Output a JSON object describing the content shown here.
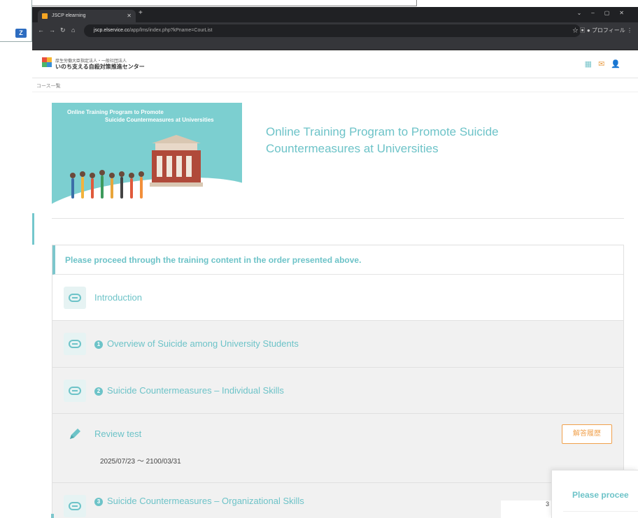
{
  "browser": {
    "tab_title": "JSCP elearning",
    "url_host": "jscp.elservice.cc",
    "url_path": "/app/lms/index.php?kPname=CourList",
    "profile_label": "プロフィール"
  },
  "taskbar": {
    "zoom_badge": "Z"
  },
  "site": {
    "org_small": "厚生労働大臣指定法人・一般社団法人",
    "org_name": "いのち支える自殺対策推進センター",
    "breadcrumb": "コース一覧"
  },
  "hero": {
    "banner_line1": "Online Training Program to Promote",
    "banner_line2": "Suicide Countermeasures at Universities",
    "title": "Online Training Program to Promote Suicide Countermeasures at Universities"
  },
  "notice": "Please proceed through the training content in the order presented above.",
  "items": [
    {
      "label": "Introduction",
      "num": "",
      "icon": "link-icon"
    },
    {
      "label": "Overview of Suicide among University Students",
      "num": "1",
      "icon": "link-icon"
    },
    {
      "label": "Suicide Countermeasures – Individual Skills",
      "num": "2",
      "icon": "link-icon"
    },
    {
      "label": "Review test",
      "num": "",
      "icon": "pencil-icon",
      "date": "2025/07/23 ～ 2100/03/31",
      "button": "解答履歴"
    },
    {
      "label": "Suicide Countermeasures – Organizational Skills",
      "num": "3",
      "icon": "link-icon"
    }
  ],
  "overlay": {
    "text": "Please procee",
    "fragment": "3"
  },
  "colors": {
    "accent": "#6dc3c8",
    "orange": "#f0a04b"
  }
}
